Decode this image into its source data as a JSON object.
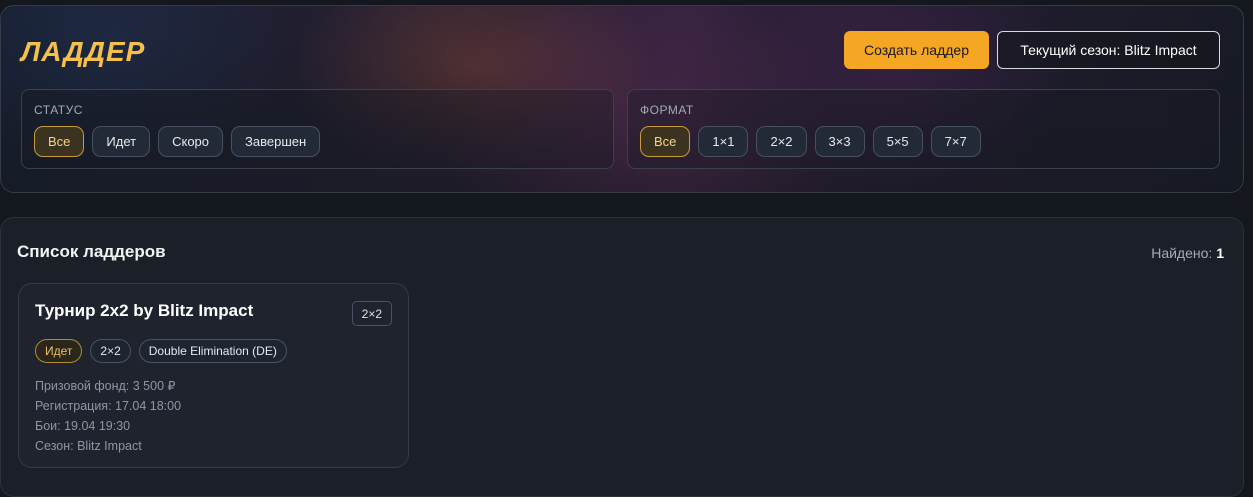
{
  "header": {
    "title": "ЛАДДЕР",
    "create_button": "Создать ладдер",
    "season_button": "Текущий сезон: Blitz Impact"
  },
  "filters": {
    "status": {
      "label": "СТАТУС",
      "options": [
        "Все",
        "Идет",
        "Скоро",
        "Завершен"
      ],
      "selected": "Все"
    },
    "format": {
      "label": "ФОРМАТ",
      "options": [
        "Все",
        "1×1",
        "2×2",
        "3×3",
        "5×5",
        "7×7"
      ],
      "selected": "Все"
    }
  },
  "list": {
    "title": "Список ладдеров",
    "found_label": "Найдено:",
    "found_count": "1",
    "cards": [
      {
        "title": "Турнир 2x2 by Blitz Impact",
        "format_badge": "2×2",
        "tags": {
          "status": "Идет",
          "format": "2×2",
          "elimination": "Double Elimination (DE)"
        },
        "meta": {
          "prize": "Призовой фонд: 3 500 ₽",
          "registration": "Регистрация: 17.04 18:00",
          "battles": "Бои: 19.04 19:30",
          "season": "Сезон: Blitz Impact"
        }
      }
    ]
  },
  "colors": {
    "accent": "#f5a623",
    "title": "#f6c14b",
    "background": "#14171d",
    "panel": "#1b1f28"
  }
}
